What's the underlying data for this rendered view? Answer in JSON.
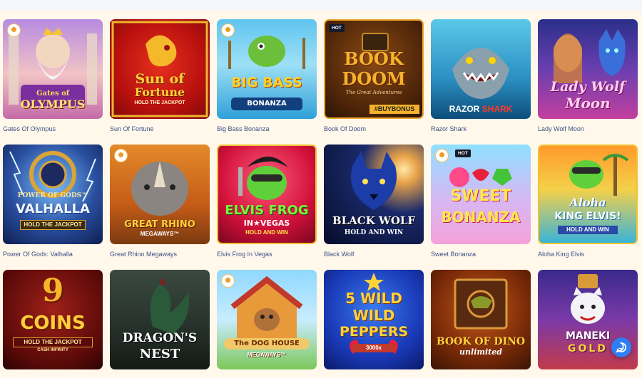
{
  "games": [
    {
      "name": "Gates Of Olympus",
      "art_title_1": "Gates of",
      "art_title_2": "OLYMPUS",
      "provider_logo": true
    },
    {
      "name": "Sun Of Fortune",
      "art_title_1": "Sun of",
      "art_title_2": "Fortune",
      "art_sub": "HOLD THE JACKPOT"
    },
    {
      "name": "Big Bass Bonanza",
      "art_title_1": "BIG BASS",
      "art_title_2": "BONANZA",
      "provider_logo": true
    },
    {
      "name": "Book Of Doom",
      "badge": "HOT",
      "art_title_1": "BOOK",
      "art_title_2": "DOOM",
      "art_sub": "The Great Adventures",
      "art_tag": "#BUYBONUS"
    },
    {
      "name": "Razor Shark",
      "art_title_1": "RAZOR",
      "art_title_2": "SHARK"
    },
    {
      "name": "Lady Wolf Moon",
      "art_title_1": "Lady Wolf",
      "art_title_2": "Moon"
    },
    {
      "name": "Power Of Gods: Valhalla",
      "art_title_1": "POWER OF GODS™",
      "art_title_2": "VALHALLA",
      "art_sub": "HOLD THE JACKPOT"
    },
    {
      "name": "Great Rhino Megaways",
      "art_title_1": "GREAT RHINO",
      "art_title_2": "MEGAWAYS™",
      "provider_logo": true
    },
    {
      "name": "Elvis Frog In Vegas",
      "art_title_1": "ELVIS FROG",
      "art_title_2": "IN★VEGAS",
      "art_sub": "HOLD AND WIN"
    },
    {
      "name": "Black Wolf",
      "art_title_1": "BLACK WOLF",
      "art_sub": "HOLD AND WIN"
    },
    {
      "name": "Sweet Bonanza",
      "badge": "HOT",
      "art_title_1": "SWEET",
      "art_title_2": "BONANZA",
      "provider_logo": true
    },
    {
      "name": "Aloha King Elvis",
      "art_title_1": "Aloha",
      "art_title_2": "KING ELVIS!",
      "art_sub": "HOLD AND WIN"
    },
    {
      "name": "",
      "art_title_1": "9",
      "art_title_2": "COINS",
      "art_sub": "HOLD THE JACKPOT",
      "art_tag": "CASH INFINITY"
    },
    {
      "name": "",
      "art_title_1": "DRAGON'S",
      "art_title_2": "NEST"
    },
    {
      "name": "",
      "art_title_1": "The DOG HOUSE",
      "art_title_2": "MEGAWAYS™",
      "provider_logo": true
    },
    {
      "name": "",
      "art_title_1": "5 WILD",
      "art_title_2": "WILD",
      "art_sub": "PEPPERS",
      "art_tag": "3000x"
    },
    {
      "name": "",
      "art_title_1": "BOOK OF DINO",
      "art_title_2": "unlimited"
    },
    {
      "name": "",
      "art_title_1": "MANEKI",
      "art_title_2": "GOLD"
    }
  ],
  "colors": {
    "accent": "#2f7ef6",
    "game_name": "#3c4f86",
    "panel": "#fff8eb"
  },
  "chat_button_icon": "chat-icon"
}
